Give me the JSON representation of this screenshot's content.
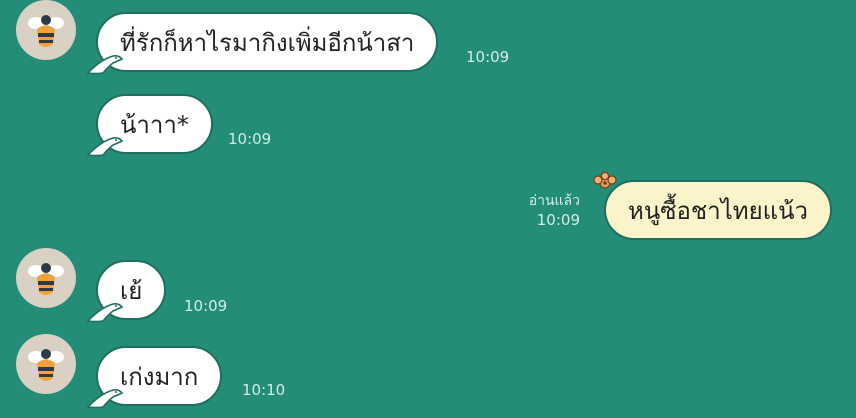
{
  "messages": [
    {
      "text": "ที่รักก็หาไรมากิงเพิ่มอีกน้าสา",
      "time": "10:09"
    },
    {
      "text": "น้าาา*",
      "time": "10:09"
    },
    {
      "text": "หนูซื้อชาไทยแน้ว",
      "time": "10:09",
      "read_label": "อ่านแล้ว"
    },
    {
      "text": "เย้",
      "time": "10:09"
    },
    {
      "text": "เก่งมาก",
      "time": "10:10"
    }
  ],
  "icons": {
    "avatar": "bee-avatar-icon",
    "incoming_tail": "bird-tail-icon",
    "outgoing_decoration": "flower-icon"
  },
  "colors": {
    "background": "#248d78",
    "incoming_bubble": "#ffffff",
    "outgoing_bubble": "#fbf3c9",
    "bubble_border": "#1f6e60",
    "meta_text": "#d4ece5"
  }
}
